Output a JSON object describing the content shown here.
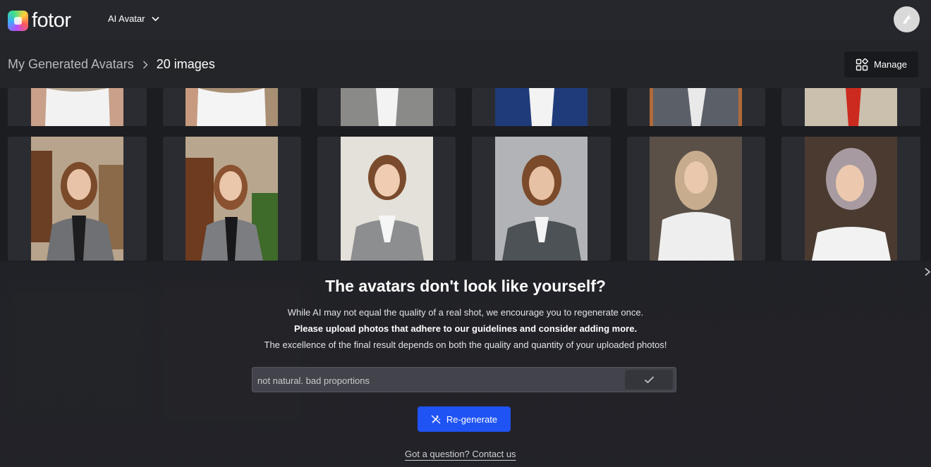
{
  "app": {
    "brand": "fotor",
    "nav_label": "AI Avatar"
  },
  "header": {
    "breadcrumb_parent": "My Generated Avatars",
    "breadcrumb_current": "20 images",
    "manage_label": "Manage"
  },
  "dialog": {
    "title": "The avatars don't look like yourself?",
    "line1": "While AI may not equal the quality of a real shot, we encourage you to regenerate once.",
    "line2": "Please upload photos that adhere to our guidelines and consider adding more.",
    "line3": "The excellence of the final result depends on both the quality and quantity of your uploaded photos!",
    "feedback_value": "not natural. bad proportions",
    "regenerate_label": "Re-generate",
    "contact_label": "Got a question? Contact us"
  },
  "icons": {
    "logo": "fotor-logo-icon",
    "nav_chevron": "chevron-down-icon",
    "user": "user-avatar-icon",
    "breadcrumb_sep": "chevron-right-icon",
    "manage": "grid-manage-icon",
    "confirm": "check-icon",
    "regenerate": "magic-wand-icon",
    "close": "close-icon"
  },
  "colors": {
    "accent": "#1f53f4",
    "topbar": "#26272c",
    "background": "#1c1d21"
  }
}
